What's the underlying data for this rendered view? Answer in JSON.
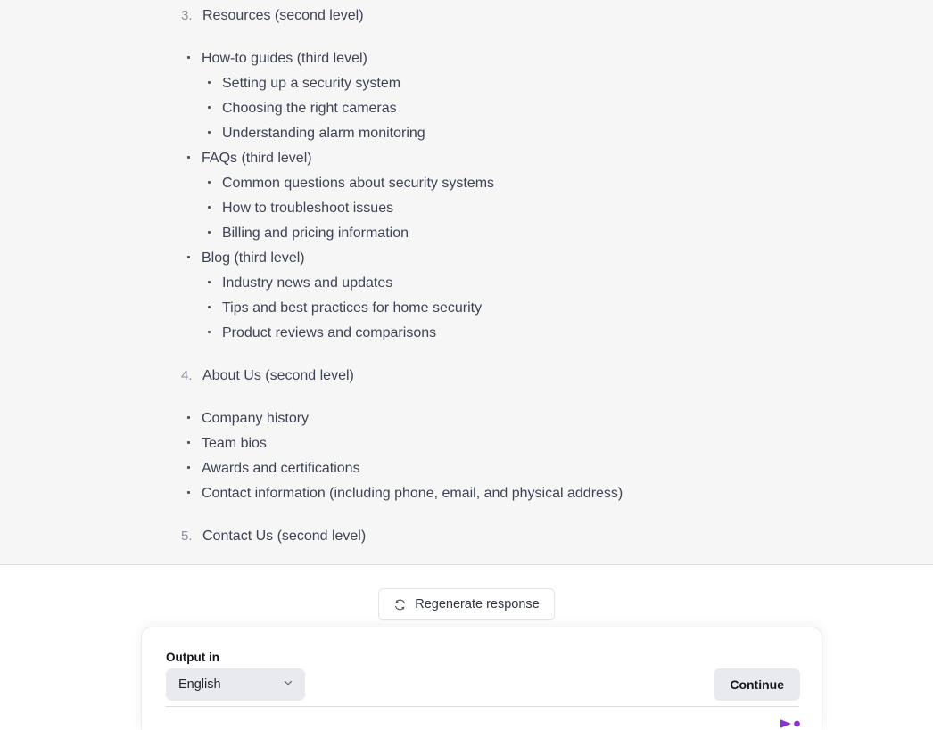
{
  "response": {
    "outline": [
      {
        "type": "ordered",
        "marker": "3.",
        "level": 2,
        "text": "Resources (second level)"
      },
      {
        "type": "bullet",
        "level": 3,
        "text": "How-to guides (third level)"
      },
      {
        "type": "bullet",
        "level": 4,
        "text": "Setting up a security system"
      },
      {
        "type": "bullet",
        "level": 4,
        "text": "Choosing the right cameras"
      },
      {
        "type": "bullet",
        "level": 4,
        "text": "Understanding alarm monitoring"
      },
      {
        "type": "bullet",
        "level": 3,
        "text": "FAQs (third level)"
      },
      {
        "type": "bullet",
        "level": 4,
        "text": "Common questions about security systems"
      },
      {
        "type": "bullet",
        "level": 4,
        "text": "How to troubleshoot issues"
      },
      {
        "type": "bullet",
        "level": 4,
        "text": "Billing and pricing information"
      },
      {
        "type": "bullet",
        "level": 3,
        "text": "Blog (third level)"
      },
      {
        "type": "bullet",
        "level": 4,
        "text": "Industry news and updates"
      },
      {
        "type": "bullet",
        "level": 4,
        "text": "Tips and best practices for home security"
      },
      {
        "type": "bullet",
        "level": 4,
        "text": "Product reviews and comparisons"
      },
      {
        "type": "ordered",
        "marker": "4.",
        "level": 2,
        "text": "About Us (second level)"
      },
      {
        "type": "bullet",
        "level": 3,
        "text": "Company history"
      },
      {
        "type": "bullet",
        "level": 3,
        "text": "Team bios"
      },
      {
        "type": "bullet",
        "level": 3,
        "text": "Awards and certifications"
      },
      {
        "type": "bullet",
        "level": 3,
        "text": "Contact information (including phone, email, and physical address)"
      },
      {
        "type": "ordered",
        "marker": "5.",
        "level": 2,
        "text": "Contact Us (second level)"
      }
    ]
  },
  "actions": {
    "regenerate_label": "Regenerate response",
    "regenerate_icon": "refresh-icon"
  },
  "composer": {
    "output_label": "Output in",
    "language_value": "English",
    "language_options": [
      "English"
    ],
    "chevron_icon": "chevron-down-icon",
    "continue_label": "Continue",
    "send_icon": "send-icon"
  },
  "colors": {
    "panel_background": "#f6f6f7",
    "text": "#3d4354",
    "marker": "#8a8f9e",
    "control_background": "#e9e9f0",
    "accent": "#8b2fd6",
    "accent_dark": "#7a1fc4",
    "divider": "#dcdce4"
  }
}
